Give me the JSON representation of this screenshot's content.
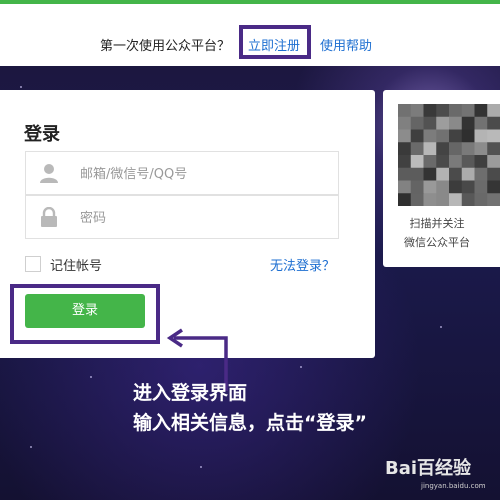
{
  "header": {
    "prompt_text": "第一次使用公众平台？",
    "register_link": "立即注册",
    "help_link": "使用帮助"
  },
  "login": {
    "title": "登录",
    "account_placeholder": "邮箱/微信号/QQ号",
    "password_placeholder": "密码",
    "remember_label": "记住帐号",
    "cant_login_link": "无法登录？",
    "submit_label": "登录"
  },
  "qr": {
    "caption_line1": "扫描并关注",
    "caption_line2": "微信公众平台"
  },
  "annotation": {
    "line1": "进入登录界面",
    "line2": "输入相关信息，点击“登录”"
  },
  "watermark": {
    "brand": "Bai百经验",
    "url": "jingyan.baidu.com"
  },
  "colors": {
    "accent_green": "#44b549",
    "link_blue": "#1e6fd1",
    "highlight_purple": "#4a2a86"
  }
}
